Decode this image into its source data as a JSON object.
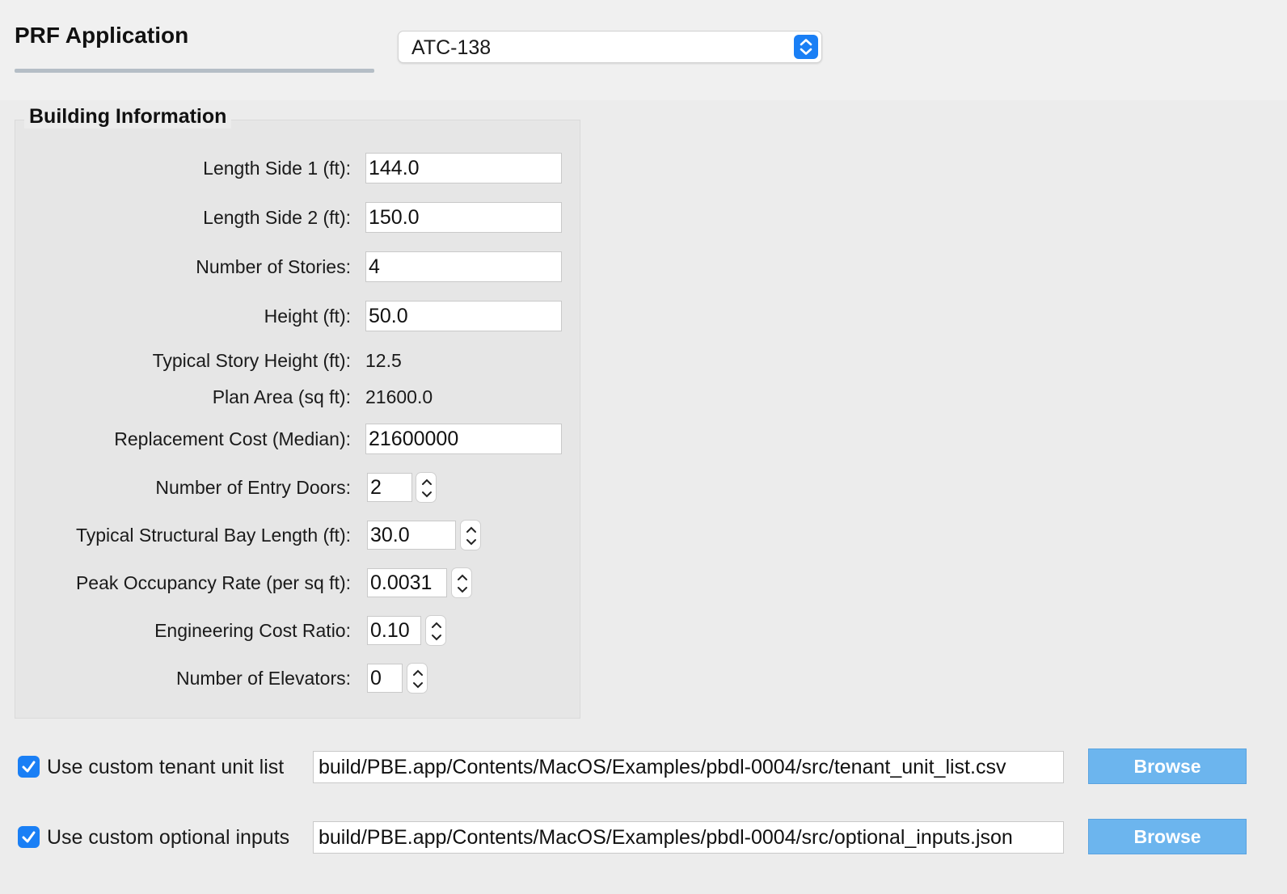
{
  "header": {
    "title": "PRF Application",
    "application_select": "ATC-138"
  },
  "building_info": {
    "title": "Building Information",
    "length_side_1": {
      "label": "Length Side 1 (ft):",
      "value": "144.0"
    },
    "length_side_2": {
      "label": "Length Side 2 (ft):",
      "value": "150.0"
    },
    "number_of_stories": {
      "label": "Number of Stories:",
      "value": "4"
    },
    "height": {
      "label": "Height (ft):",
      "value": "50.0"
    },
    "typical_story_height": {
      "label": "Typical Story Height (ft):",
      "value": "12.5"
    },
    "plan_area": {
      "label": "Plan Area (sq ft):",
      "value": "21600.0"
    },
    "replacement_cost": {
      "label": "Replacement Cost (Median):",
      "value": "21600000"
    },
    "entry_doors": {
      "label": "Number of Entry Doors:",
      "value": "2"
    },
    "bay_length": {
      "label": "Typical Structural Bay Length (ft):",
      "value": "30.0"
    },
    "occupancy_rate": {
      "label": "Peak Occupancy Rate (per sq ft):",
      "value": "0.0031"
    },
    "engineering_cost_ratio": {
      "label": "Engineering Cost Ratio:",
      "value": "0.10"
    },
    "elevators": {
      "label": "Number of Elevators:",
      "value": "0"
    }
  },
  "custom_files": {
    "tenant": {
      "checked": true,
      "label": "Use custom tenant unit list",
      "path": "build/PBE.app/Contents/MacOS/Examples/pbdl-0004/src/tenant_unit_list.csv",
      "browse_label": "Browse"
    },
    "optional": {
      "checked": true,
      "label": "Use custom optional inputs",
      "path": "build/PBE.app/Contents/MacOS/Examples/pbdl-0004/src/optional_inputs.json",
      "browse_label": "Browse"
    }
  },
  "colors": {
    "accent": "#1a7ff5",
    "browse_button": "#6cb5ee",
    "title_rule": "#b5bec6"
  }
}
